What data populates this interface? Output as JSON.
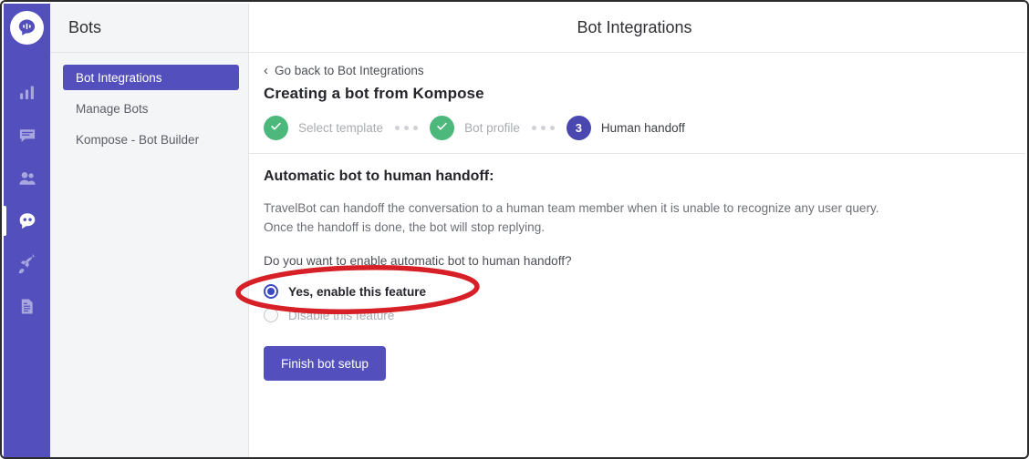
{
  "colors": {
    "rail_purple": "#5350bd",
    "accent_purple": "#5350bd",
    "step_done_green": "#4cb87c",
    "step_current_purple": "#4a47b0",
    "radio_checked": "#3a48c4",
    "annotation_red": "#d61f26",
    "sidebar_bg": "#f4f5f7"
  },
  "rail": {
    "logo_icon": "chat-bubble-waveform-logo",
    "items": [
      {
        "icon": "bar-chart-icon",
        "active": false
      },
      {
        "icon": "chat-message-icon",
        "active": false
      },
      {
        "icon": "users-icon",
        "active": false
      },
      {
        "icon": "bot-icon",
        "active": true
      },
      {
        "icon": "rocket-icon",
        "active": false
      },
      {
        "icon": "document-icon",
        "active": false
      }
    ]
  },
  "sidebar": {
    "title": "Bots",
    "items": [
      {
        "label": "Bot Integrations",
        "active": true
      },
      {
        "label": "Manage Bots",
        "active": false
      },
      {
        "label": "Kompose - Bot Builder",
        "active": false
      }
    ]
  },
  "header": {
    "title": "Bot Integrations"
  },
  "wizard": {
    "back_link": "Go back to Bot Integrations",
    "back_icon": "chevron-left-icon",
    "heading": "Creating a bot from Kompose",
    "steps": [
      {
        "label": "Select template",
        "state": "done",
        "number": "1",
        "check_icon": "check-icon"
      },
      {
        "label": "Bot profile",
        "state": "done",
        "number": "2",
        "check_icon": "check-icon"
      },
      {
        "label": "Human handoff",
        "state": "current",
        "number": "3"
      }
    ]
  },
  "content": {
    "section_title": "Automatic bot to human handoff:",
    "paragraph_line_1": "TravelBot can handoff the conversation to a human team member when it is unable to recognize any user query.",
    "paragraph_line_2": "Once the handoff is done, the bot will stop replying.",
    "question": "Do you want to enable automatic bot to human handoff?",
    "options": [
      {
        "label": "Yes, enable this feature",
        "selected": true
      },
      {
        "label": "Disable this feature",
        "selected": false
      }
    ],
    "submit_button": "Finish bot setup"
  },
  "annotation": {
    "shape": "red-ellipse-highlight",
    "target": "Yes, enable this feature"
  }
}
